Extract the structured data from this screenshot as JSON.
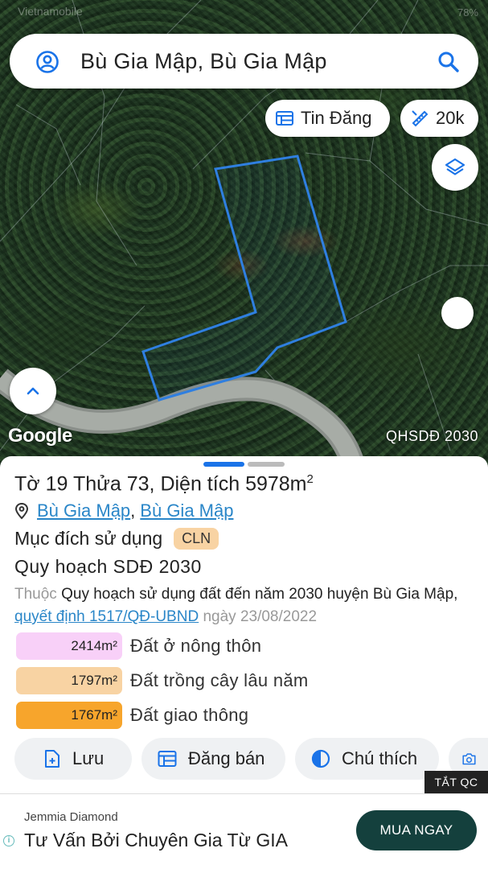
{
  "status_bar": {
    "carrier": "Vietnamobile",
    "battery": "78%"
  },
  "search": {
    "title": "Bù Gia Mập, Bù Gia Mập"
  },
  "map": {
    "listings_chip": "Tin Đăng",
    "scale_chip": "20k",
    "google_logo": "Google",
    "layer_label": "QHSDĐ 2030",
    "parcel_outline_color": "#2f7fe0"
  },
  "parcel": {
    "sheet_label": "Tờ",
    "sheet_no": "19",
    "plot_label": "Thửa",
    "plot_no": "73",
    "area_label": "Diện tích",
    "area_value": "5978m",
    "area_unit_sup": "2",
    "address_part1": "Bù Gia Mập",
    "address_part2": "Bù Gia Mập",
    "purpose_label": "Mục đích sử dụng",
    "purpose_code": "CLN"
  },
  "plan": {
    "title": "Quy hoạch SDĐ 2030",
    "prefix": "Thuộc",
    "name": "Quy hoạch sử dụng đất đến năm 2030 huyện Bù Gia Mập",
    "decision_link": "quyết định 1517/QĐ-UBND",
    "date_prefix": "ngày",
    "date": "23/08/2022"
  },
  "land_use": [
    {
      "area": "2414m²",
      "label": "Đất ở nông thôn",
      "color": "#f8d0f8"
    },
    {
      "area": "1797m²",
      "label": "Đất trồng cây lâu năm",
      "color": "#f8d3a3"
    },
    {
      "area": "1767m²",
      "label": "Đất giao thông",
      "color": "#f7a52c"
    }
  ],
  "actions": {
    "save": "Lưu",
    "post_sale": "Đăng bán",
    "legend": "Chú thích"
  },
  "ad": {
    "close_label": "TẮT QC",
    "brand": "Jemmia Diamond",
    "headline": "Tư Vấn Bởi Chuyên Gia Từ GIA",
    "cta": "MUA NGAY"
  },
  "colors": {
    "link": "#2a86c8",
    "accent_blue": "#2f7fe0",
    "cta_bg": "#14403d"
  }
}
